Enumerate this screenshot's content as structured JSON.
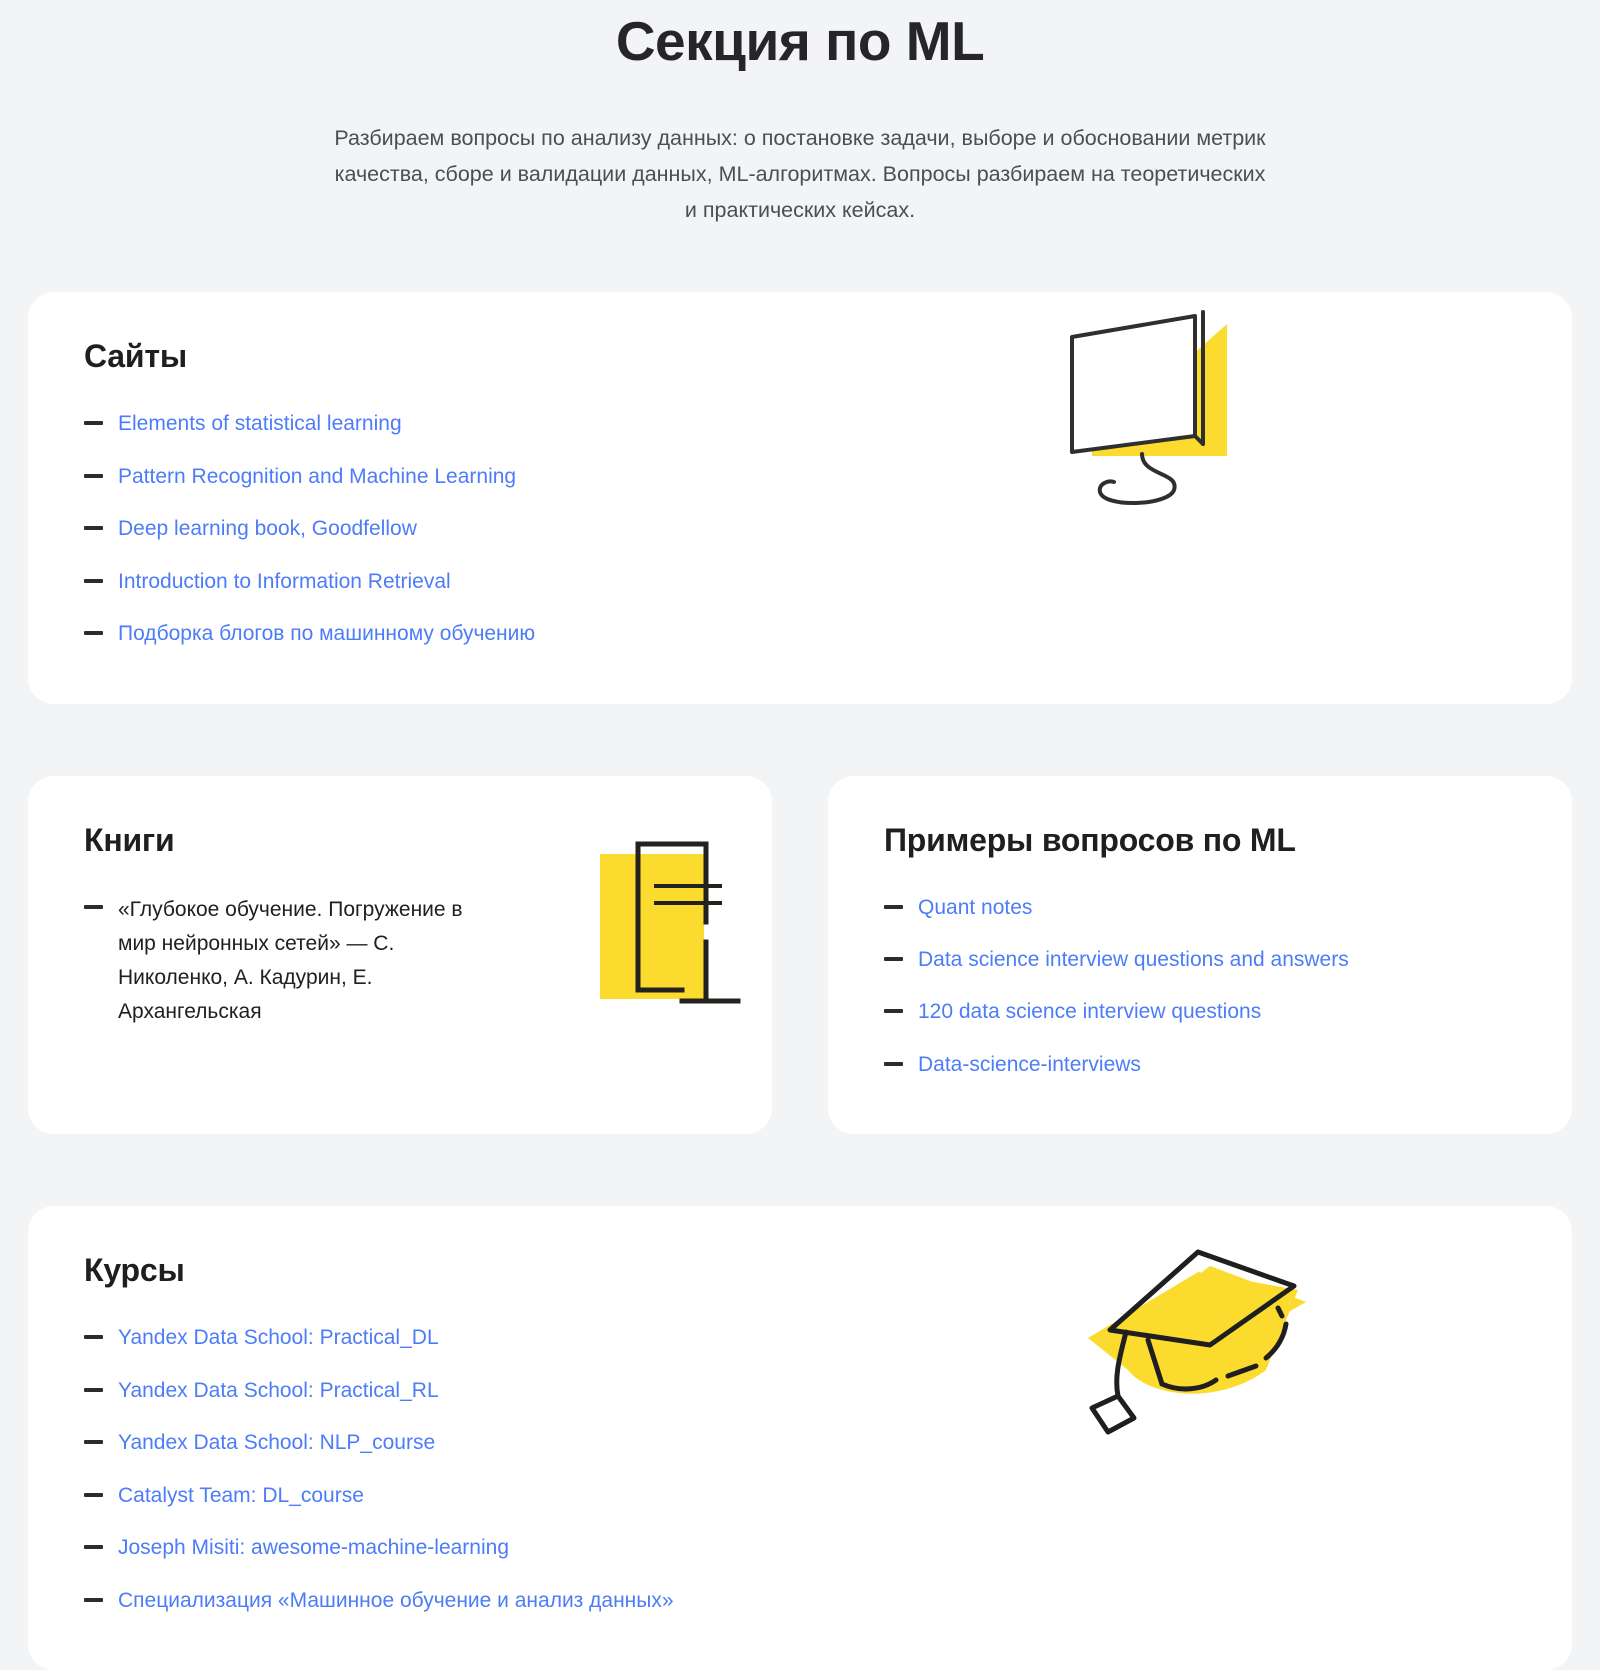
{
  "header": {
    "title": "Секция по ML",
    "subtitle": "Разбираем вопросы по анализу данных: о постановке задачи, выборе и обосновании метрик качества, сборе и валидации данных, ML-алгоритмах. Вопросы разбираем на теоретических и практических кейсах."
  },
  "colors": {
    "background": "#f3f4f6",
    "card": "#ffffff",
    "link": "#4d7cf9",
    "accent_yellow": "#fbdb2e",
    "text_dark": "#21201f",
    "dash": "#2c2c2c"
  },
  "cards": [
    {
      "id": "sites",
      "title": "Сайты",
      "illustration": "monitor-illustration",
      "items": [
        {
          "label": "Elements of statistical learning",
          "link": true
        },
        {
          "label": "Pattern Recognition and Machine Learning",
          "link": true
        },
        {
          "label": "Deep learning book, Goodfellow",
          "link": true
        },
        {
          "label": "Introduction to Information Retrieval",
          "link": true
        },
        {
          "label": "Подборка блогов по машинному обучению",
          "link": true
        }
      ]
    },
    {
      "id": "books",
      "title": "Книги",
      "illustration": "book-illustration",
      "items": [
        {
          "label": "«Глубокое обучение. Погружение в мир нейронных сетей» — С. Николенко, А. Кадурин, Е. Архангельская",
          "link": false
        }
      ]
    },
    {
      "id": "questions",
      "title": "Примеры вопросов по ML",
      "illustration": "none",
      "items": [
        {
          "label": "Quant notes",
          "link": true
        },
        {
          "label": "Data science interview questions and answers",
          "link": true
        },
        {
          "label": "120 data science interview questions",
          "link": true
        },
        {
          "label": "Data-science-interviews",
          "link": true
        }
      ]
    },
    {
      "id": "courses",
      "title": "Курсы",
      "illustration": "graduation-cap-illustration",
      "items": [
        {
          "label": "Yandex Data School: Practical_DL",
          "link": true
        },
        {
          "label": "Yandex Data School: Practical_RL",
          "link": true
        },
        {
          "label": "Yandex Data School: NLP_course",
          "link": true
        },
        {
          "label": "Catalyst Team: DL_course",
          "link": true
        },
        {
          "label": "Joseph Misiti: awesome-machine-learning",
          "link": true
        },
        {
          "label": "Специализация «Машинное обучение и анализ данных»",
          "link": true
        }
      ]
    }
  ]
}
